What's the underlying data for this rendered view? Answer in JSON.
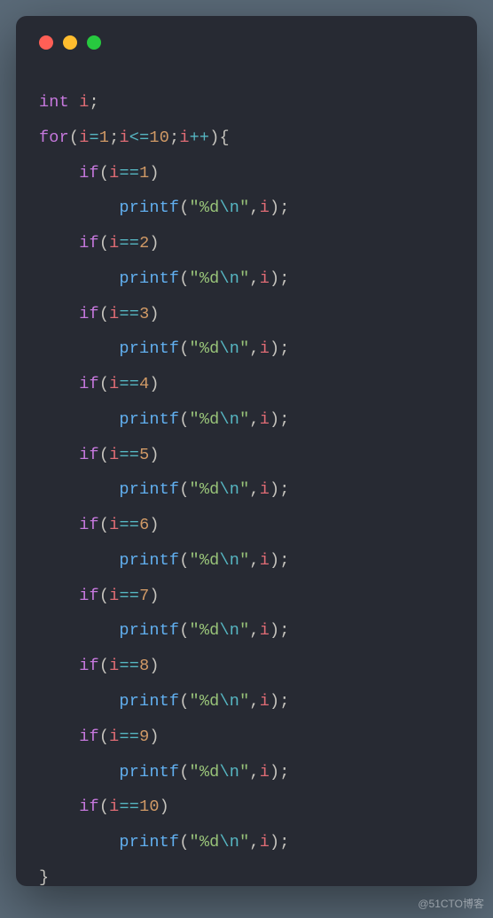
{
  "traffic_lights": [
    "red",
    "yellow",
    "green"
  ],
  "watermark": "@51CTO博客",
  "code": {
    "decl": {
      "type": "int",
      "ident": "i"
    },
    "for": {
      "kw": "for",
      "init": {
        "ident": "i",
        "value": "1"
      },
      "cond": {
        "ident": "i",
        "op": "<=",
        "value": "10"
      },
      "inc": {
        "ident": "i",
        "op": "++"
      }
    },
    "body": [
      {
        "ident": "i",
        "value": "1",
        "call": "printf",
        "fmt": "\"%d",
        "esc": "\\n",
        "fmt2": "\"",
        "arg": "i"
      },
      {
        "ident": "i",
        "value": "2",
        "call": "printf",
        "fmt": "\"%d",
        "esc": "\\n",
        "fmt2": "\"",
        "arg": "i"
      },
      {
        "ident": "i",
        "value": "3",
        "call": "printf",
        "fmt": "\"%d",
        "esc": "\\n",
        "fmt2": "\"",
        "arg": "i"
      },
      {
        "ident": "i",
        "value": "4",
        "call": "printf",
        "fmt": "\"%d",
        "esc": "\\n",
        "fmt2": "\"",
        "arg": "i"
      },
      {
        "ident": "i",
        "value": "5",
        "call": "printf",
        "fmt": "\"%d",
        "esc": "\\n",
        "fmt2": "\"",
        "arg": "i"
      },
      {
        "ident": "i",
        "value": "6",
        "call": "printf",
        "fmt": "\"%d",
        "esc": "\\n",
        "fmt2": "\"",
        "arg": "i"
      },
      {
        "ident": "i",
        "value": "7",
        "call": "printf",
        "fmt": "\"%d",
        "esc": "\\n",
        "fmt2": "\"",
        "arg": "i"
      },
      {
        "ident": "i",
        "value": "8",
        "call": "printf",
        "fmt": "\"%d",
        "esc": "\\n",
        "fmt2": "\"",
        "arg": "i"
      },
      {
        "ident": "i",
        "value": "9",
        "call": "printf",
        "fmt": "\"%d",
        "esc": "\\n",
        "fmt2": "\"",
        "arg": "i"
      },
      {
        "ident": "i",
        "value": "10",
        "call": "printf",
        "fmt": "\"%d",
        "esc": "\\n",
        "fmt2": "\"",
        "arg": "i"
      }
    ],
    "if_kw": "if"
  }
}
